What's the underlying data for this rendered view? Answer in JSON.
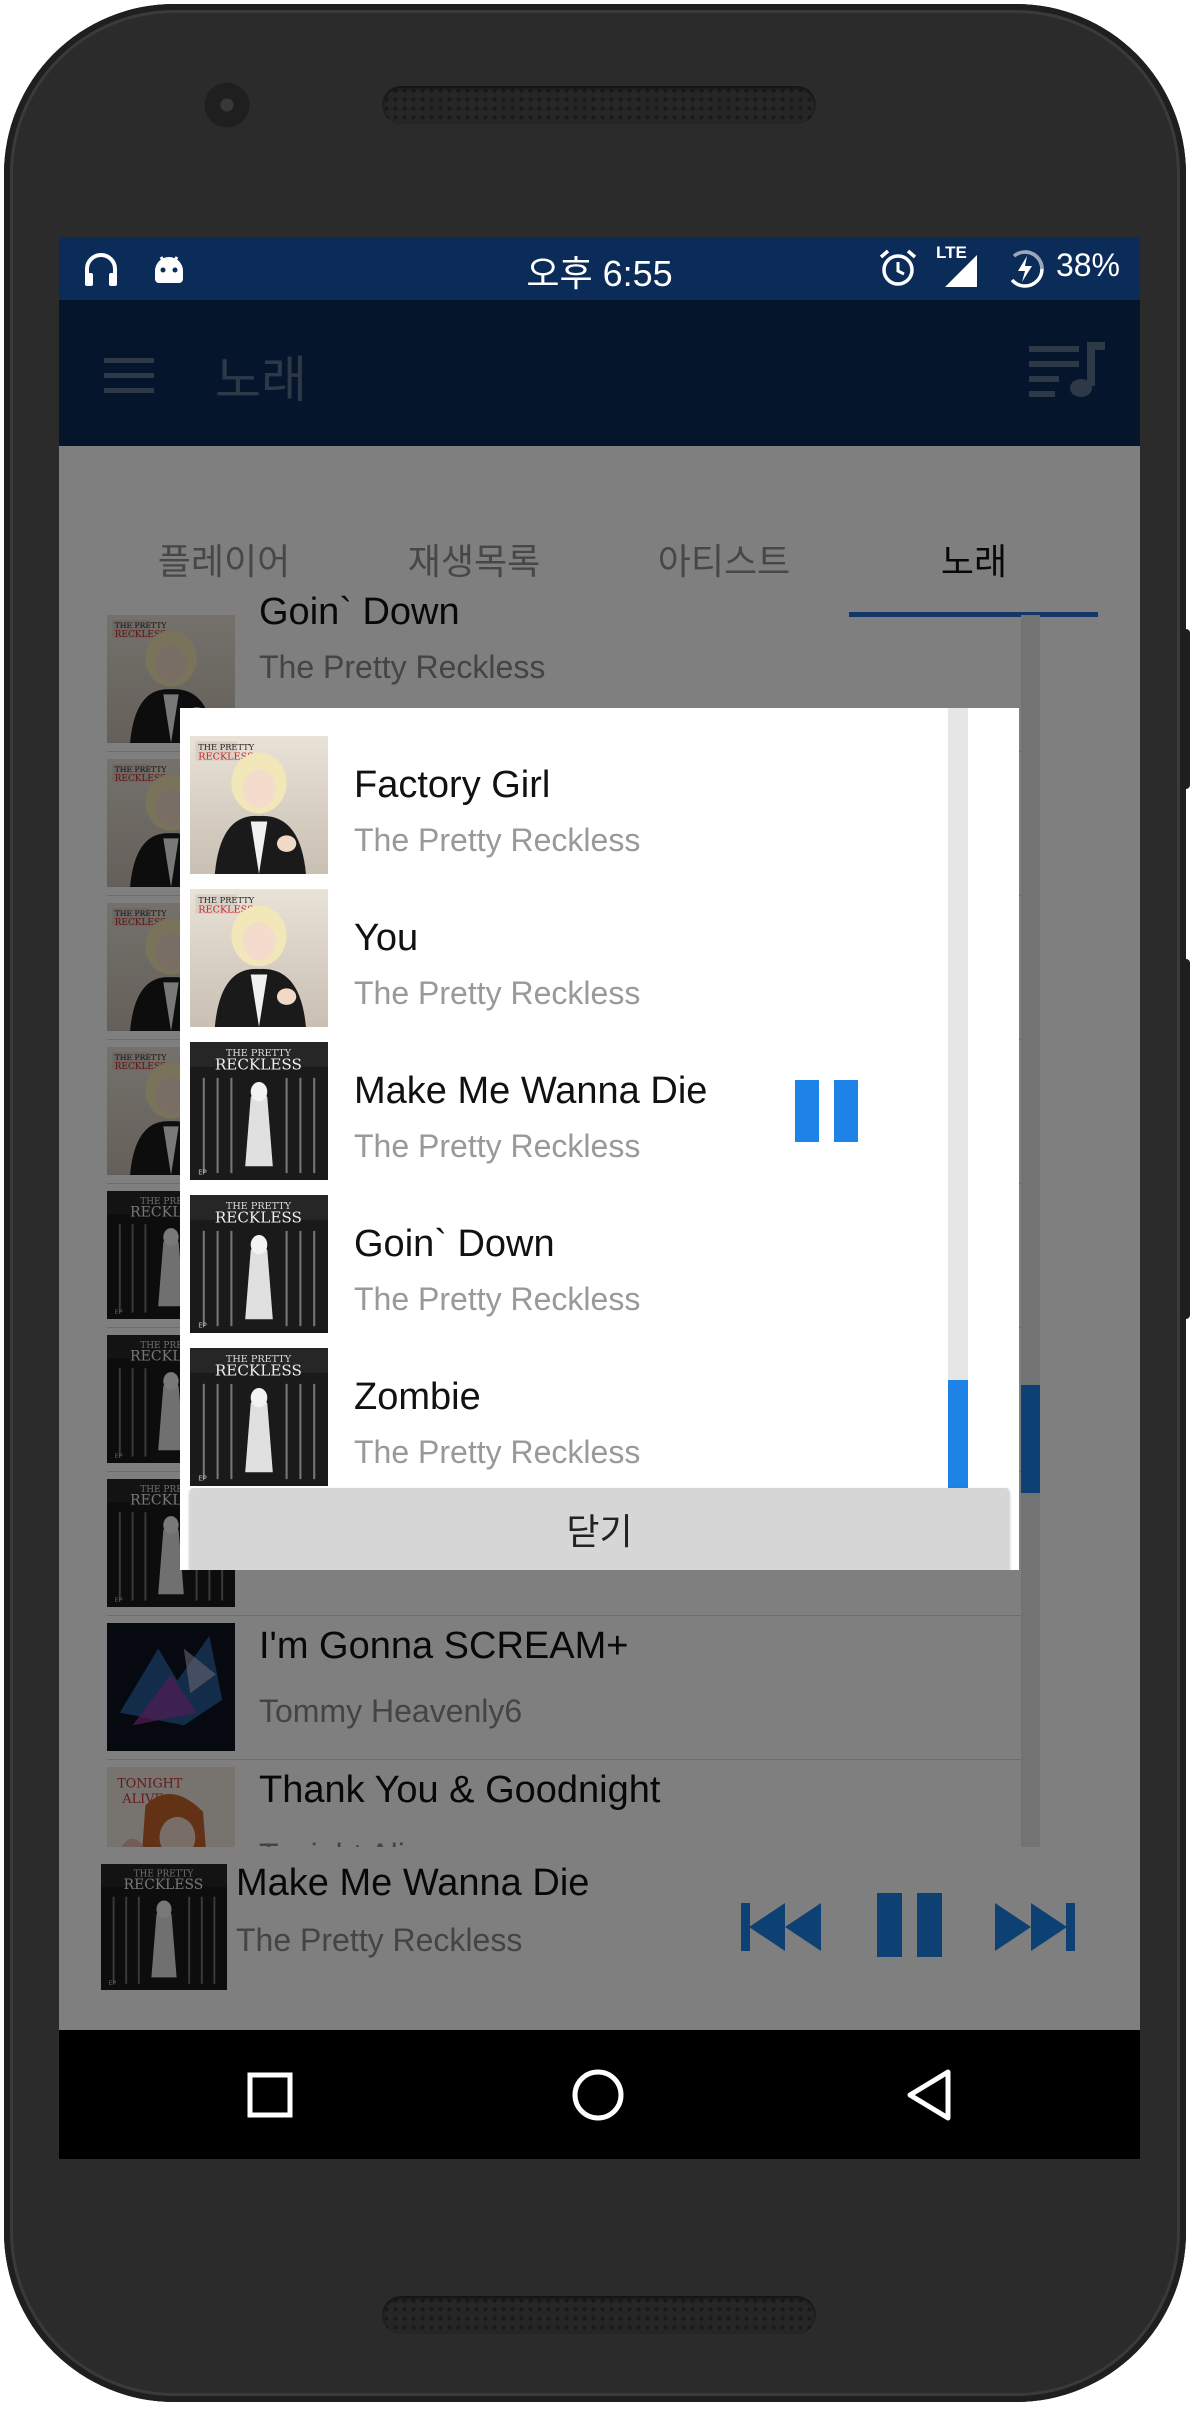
{
  "statusbar": {
    "time": "오후 6:55",
    "battery": "38%",
    "network": "LTE",
    "icons": [
      "headphones-icon",
      "android-debug-icon",
      "alarm-icon",
      "signal-icon",
      "battery-charging-icon"
    ]
  },
  "toolbar": {
    "title": "노래",
    "menu_icon": "hamburger-menu-icon",
    "queue_icon": "queue-music-icon"
  },
  "tabs": [
    {
      "label": "플레이어",
      "active": false
    },
    {
      "label": "재생목록",
      "active": false
    },
    {
      "label": "아티스트",
      "active": false
    },
    {
      "label": "노래",
      "active": true
    }
  ],
  "songs": [
    {
      "title": "Goin` Down",
      "artist": "The Pretty Reckless"
    },
    {
      "title": "I'm Gonna SCREAM+",
      "artist": "Tommy Heavenly6"
    },
    {
      "title": "Thank You & Goodnight",
      "artist": "Tonight Alive"
    }
  ],
  "dialog": {
    "items": [
      {
        "title": "Factory Girl",
        "artist": "The Pretty Reckless"
      },
      {
        "title": "You",
        "artist": "The Pretty Reckless"
      },
      {
        "title": "Make Me Wanna Die",
        "artist": "The Pretty Reckless",
        "playing": true
      },
      {
        "title": "Goin` Down",
        "artist": "The Pretty Reckless"
      },
      {
        "title": "Zombie",
        "artist": "The Pretty Reckless"
      }
    ],
    "close_label": "닫기"
  },
  "now_playing": {
    "title": "Make Me Wanna Die",
    "artist": "The Pretty Reckless"
  },
  "colors": {
    "primary": "#0b2b58",
    "accent": "#1d83e6",
    "tab_indicator": "#2a6fd1"
  },
  "navbar": {
    "icons": [
      "recents-icon",
      "home-icon",
      "back-icon"
    ]
  }
}
